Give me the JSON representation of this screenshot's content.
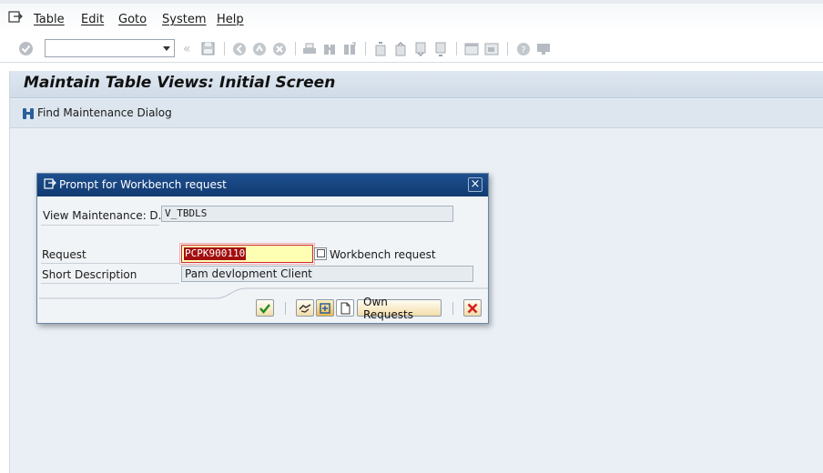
{
  "menu": {
    "items": [
      "Table",
      "Edit",
      "Goto",
      "System",
      "Help"
    ]
  },
  "toolbar": {
    "command_field_value": "",
    "icons": [
      "enter-icon",
      "save-icon",
      "back-icon",
      "exit-icon",
      "cancel-icon",
      "print-icon",
      "find-icon",
      "find-next-icon",
      "first-page-icon",
      "prev-page-icon",
      "next-page-icon",
      "last-page-icon",
      "new-session-icon",
      "shortcut-icon",
      "help-icon",
      "layout-icon"
    ]
  },
  "screen": {
    "title": "Maintain Table Views: Initial Screen",
    "find_button_label": "Find Maintenance Dialog"
  },
  "dialog": {
    "title": "Prompt for Workbench request",
    "view_label": "View Maintenance: D...",
    "view_value": "V_TBDLS",
    "request_label": "Request",
    "request_value": "PCPK900110",
    "request_type": "Workbench request",
    "short_desc_label": "Short Description",
    "short_desc_value": "Pam devlopment Client",
    "own_requests_label": "Own Requests"
  },
  "colors": {
    "title_bar": "#1d4f8f",
    "background": "#e9eff5",
    "selection": "#a30f0f",
    "required_field": "#ffffb4"
  }
}
